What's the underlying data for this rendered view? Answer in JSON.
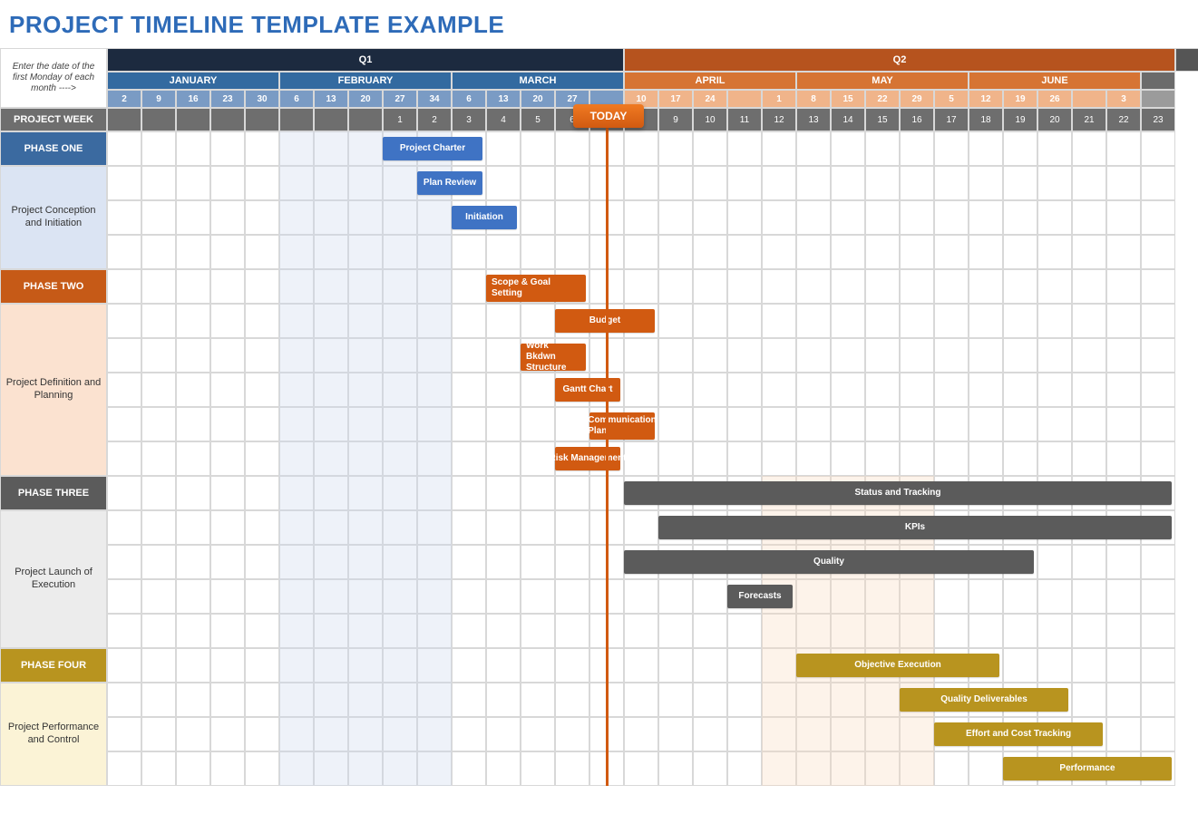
{
  "title": "PROJECT TIMELINE TEMPLATE EXAMPLE",
  "corner_note": "Enter the date of the first Monday of each month ---->",
  "project_week_label": "PROJECT WEEK",
  "today_label": "TODAY",
  "quarters": [
    {
      "label": "Q1",
      "span": 15,
      "bg": "#1c2a3f"
    },
    {
      "label": "Q2",
      "span": 16,
      "bg": "#b6531e"
    },
    {
      "label": "",
      "span": 1,
      "bg": "#555"
    }
  ],
  "months": [
    {
      "label": "JANUARY",
      "span": 5,
      "bg": "#336aa0"
    },
    {
      "label": "FEBRUARY",
      "span": 5,
      "bg": "#336aa0"
    },
    {
      "label": "MARCH",
      "span": 5,
      "bg": "#336aa0"
    },
    {
      "label": "APRIL",
      "span": 5,
      "bg": "#d67433"
    },
    {
      "label": "MAY",
      "span": 5,
      "bg": "#d67433"
    },
    {
      "label": "JUNE",
      "span": 5,
      "bg": "#d67433"
    },
    {
      "label": "",
      "span": 1,
      "bg": "#6b6b6b"
    }
  ],
  "month_sub_bg": [
    "#7a9bc4",
    "#7a9bc4",
    "#7a9bc4",
    "#f0b48a",
    "#f0b48a",
    "#f0b48a",
    "#9b9b9b"
  ],
  "days": [
    "2",
    "9",
    "16",
    "23",
    "30",
    "6",
    "13",
    "20",
    "27",
    "34",
    "6",
    "13",
    "20",
    "27",
    "",
    "10",
    "17",
    "24",
    "",
    "1",
    "8",
    "15",
    "22",
    "29",
    "5",
    "12",
    "19",
    "26",
    "",
    "3"
  ],
  "weeks": [
    "",
    "",
    "",
    "",
    "",
    "",
    "",
    "",
    "1",
    "2",
    "3",
    "4",
    "5",
    "6",
    "7",
    "8",
    "9",
    "10",
    "11",
    "12",
    "13",
    "14",
    "15",
    "16",
    "17",
    "18",
    "19",
    "20",
    "21",
    "22",
    "23"
  ],
  "week_row_bg": "#6e6e6e",
  "phases": [
    {
      "label": "PHASE ONE",
      "hdr_bg": "#3b6aa0",
      "sub_bg": "#dbe4f3",
      "sub_label": "Project Conception and Initiation",
      "rows": 4,
      "shade": {
        "start": 6,
        "span": 5,
        "color": "#cfd9ef"
      },
      "tasks": [
        {
          "label": "Project Charter",
          "start": 9,
          "span": 3,
          "bg": "#3f73c4",
          "row": 0
        },
        {
          "label": "Plan Review",
          "start": 10,
          "span": 2,
          "bg": "#3f73c4",
          "row": 1
        },
        {
          "label": "Initiation",
          "start": 11,
          "span": 2,
          "bg": "#3f73c4",
          "row": 2
        }
      ]
    },
    {
      "label": "PHASE TWO",
      "hdr_bg": "#c65a17",
      "sub_bg": "#fbe2d0",
      "sub_label": "Project Definition and Planning",
      "rows": 6,
      "shade": {
        "start": 6,
        "span": 5,
        "color": "#cfd9ef"
      },
      "tasks": [
        {
          "label": "Scope & Goal Setting",
          "start": 12,
          "span": 3,
          "bg": "#d15a11",
          "row": 0,
          "twoLine": true
        },
        {
          "label": "Budget",
          "start": 14,
          "span": 3,
          "bg": "#d15a11",
          "row": 1
        },
        {
          "label": "Work Bkdwn Structure",
          "start": 13,
          "span": 2,
          "bg": "#d15a11",
          "row": 2,
          "twoLine": true
        },
        {
          "label": "Gantt Chart",
          "start": 14,
          "span": 2,
          "bg": "#d15a11",
          "row": 3
        },
        {
          "label": "Communication Plan",
          "start": 15,
          "span": 2,
          "bg": "#d15a11",
          "row": 4,
          "twoLine": true
        },
        {
          "label": "Risk Management",
          "start": 14,
          "span": 2,
          "bg": "#d15a11",
          "row": 5
        }
      ]
    },
    {
      "label": "PHASE THREE",
      "hdr_bg": "#5b5b5b",
      "sub_bg": "#ececec",
      "sub_label": "Project Launch of Execution",
      "rows": 5,
      "shade": {
        "start": 6,
        "span": 5,
        "color": "#cfd9ef"
      },
      "shade2": {
        "start": 20,
        "span": 5,
        "color": "#f9dcc4"
      },
      "tasks": [
        {
          "label": "Status  and Tracking",
          "start": 16,
          "span": 16,
          "bg": "#5b5b5b",
          "row": 0
        },
        {
          "label": "KPIs",
          "start": 17,
          "span": 15,
          "bg": "#5b5b5b",
          "row": 1
        },
        {
          "label": "Quality",
          "start": 16,
          "span": 12,
          "bg": "#5b5b5b",
          "row": 2
        },
        {
          "label": "Forecasts",
          "start": 19,
          "span": 2,
          "bg": "#5b5b5b",
          "row": 3
        }
      ]
    },
    {
      "label": "PHASE FOUR",
      "hdr_bg": "#b8941f",
      "sub_bg": "#fbf3d6",
      "sub_label": "Project Performance and Control",
      "rows": 4,
      "shade": {
        "start": 6,
        "span": 5,
        "color": "#cfd9ef"
      },
      "shade2": {
        "start": 20,
        "span": 5,
        "color": "#f9dcc4"
      },
      "tasks": [
        {
          "label": "Objective Execution",
          "start": 21,
          "span": 6,
          "bg": "#b8941f",
          "row": 0
        },
        {
          "label": "Quality Deliverables",
          "start": 24,
          "span": 5,
          "bg": "#b8941f",
          "row": 1
        },
        {
          "label": "Effort and Cost Tracking",
          "start": 25,
          "span": 5,
          "bg": "#b8941f",
          "row": 2
        },
        {
          "label": "Performance",
          "start": 27,
          "span": 5,
          "bg": "#b8941f",
          "row": 3
        }
      ]
    }
  ],
  "today_col": 15,
  "chart_data": {
    "type": "gantt",
    "title": "PROJECT TIMELINE TEMPLATE EXAMPLE",
    "x_unit": "project_week",
    "x_range": [
      1,
      23
    ],
    "today_week": 7,
    "quarters": [
      "Q1",
      "Q2"
    ],
    "months": [
      "JANUARY",
      "FEBRUARY",
      "MARCH",
      "APRIL",
      "MAY",
      "JUNE"
    ],
    "series": [
      {
        "phase": "PHASE ONE",
        "group": "Project Conception and Initiation",
        "task": "Project Charter",
        "start_week": 1,
        "duration_weeks": 3
      },
      {
        "phase": "PHASE ONE",
        "group": "Project Conception and Initiation",
        "task": "Plan Review",
        "start_week": 2,
        "duration_weeks": 2
      },
      {
        "phase": "PHASE ONE",
        "group": "Project Conception and Initiation",
        "task": "Initiation",
        "start_week": 3,
        "duration_weeks": 2
      },
      {
        "phase": "PHASE TWO",
        "group": "Project Definition and Planning",
        "task": "Scope & Goal Setting",
        "start_week": 4,
        "duration_weeks": 3
      },
      {
        "phase": "PHASE TWO",
        "group": "Project Definition and Planning",
        "task": "Budget",
        "start_week": 6,
        "duration_weeks": 3
      },
      {
        "phase": "PHASE TWO",
        "group": "Project Definition and Planning",
        "task": "Work Bkdwn Structure",
        "start_week": 5,
        "duration_weeks": 2
      },
      {
        "phase": "PHASE TWO",
        "group": "Project Definition and Planning",
        "task": "Gantt Chart",
        "start_week": 6,
        "duration_weeks": 2
      },
      {
        "phase": "PHASE TWO",
        "group": "Project Definition and Planning",
        "task": "Communication Plan",
        "start_week": 7,
        "duration_weeks": 2
      },
      {
        "phase": "PHASE TWO",
        "group": "Project Definition and Planning",
        "task": "Risk Management",
        "start_week": 6,
        "duration_weeks": 2
      },
      {
        "phase": "PHASE THREE",
        "group": "Project Launch of Execution",
        "task": "Status and Tracking",
        "start_week": 8,
        "duration_weeks": 16
      },
      {
        "phase": "PHASE THREE",
        "group": "Project Launch of Execution",
        "task": "KPIs",
        "start_week": 9,
        "duration_weeks": 15
      },
      {
        "phase": "PHASE THREE",
        "group": "Project Launch of Execution",
        "task": "Quality",
        "start_week": 8,
        "duration_weeks": 12
      },
      {
        "phase": "PHASE THREE",
        "group": "Project Launch of Execution",
        "task": "Forecasts",
        "start_week": 11,
        "duration_weeks": 2
      },
      {
        "phase": "PHASE FOUR",
        "group": "Project Performance and Control",
        "task": "Objective Execution",
        "start_week": 13,
        "duration_weeks": 6
      },
      {
        "phase": "PHASE FOUR",
        "group": "Project Performance and Control",
        "task": "Quality Deliverables",
        "start_week": 16,
        "duration_weeks": 5
      },
      {
        "phase": "PHASE FOUR",
        "group": "Project Performance and Control",
        "task": "Effort and Cost Tracking",
        "start_week": 17,
        "duration_weeks": 5
      },
      {
        "phase": "PHASE FOUR",
        "group": "Project Performance and Control",
        "task": "Performance",
        "start_week": 19,
        "duration_weeks": 5
      }
    ]
  }
}
